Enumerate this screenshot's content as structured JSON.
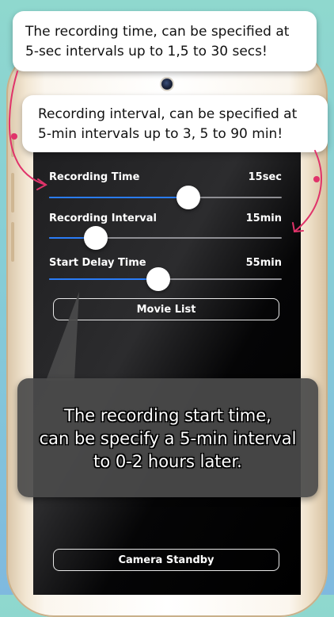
{
  "callouts": {
    "recording_time": {
      "line1": "The recording time, can be specified at",
      "line2": "5-sec intervals up to 1,5 to 30 secs!"
    },
    "recording_interval": {
      "line1": "Recording interval, can be specified at",
      "line2": "5-min intervals up to 3, 5 to 90 min!"
    },
    "start_delay": {
      "line1": "The recording start time,",
      "line2": "can be specify a 5-min interval",
      "line3": "to 0-2 hours later."
    }
  },
  "settings": {
    "recording_time": {
      "label": "Recording Time",
      "value": "15sec",
      "slider_fraction": 0.6
    },
    "recording_interval": {
      "label": "Recording Interval",
      "value": "15min",
      "slider_fraction": 0.2
    },
    "start_delay": {
      "label": "Start Delay Time",
      "value": "55min",
      "slider_fraction": 0.47
    }
  },
  "buttons": {
    "movie_list": "Movie List",
    "camera_standby": "Camera Standby"
  },
  "colors": {
    "slider_fill": "#2a7cf7",
    "arrow": "#e0336a",
    "background_top": "#8fd8ce",
    "background_bottom": "#7fb9df"
  }
}
